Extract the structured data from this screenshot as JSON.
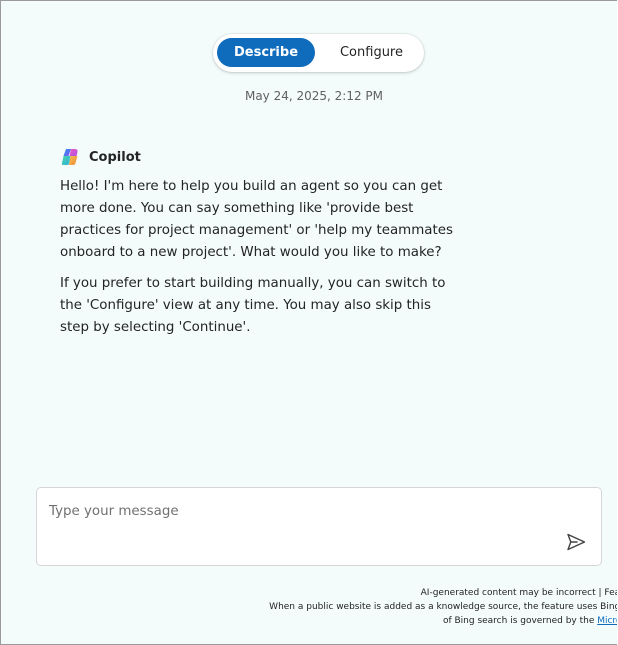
{
  "tabs": {
    "describe": "Describe",
    "configure": "Configure",
    "active": "Describe"
  },
  "timestamp": "May 24, 2025, 2:12 PM",
  "message": {
    "sender": "Copilot",
    "paragraph_1": "Hello! I'm here to help you build an agent so you can get more done. You can say something like 'provide best practices for project management' or 'help my teammates onboard to a new project'. What would you like to make?",
    "paragraph_2": "If you prefer to start building manually, you can switch to the 'Configure' view at any time. You may also skip this step by selecting 'Continue'."
  },
  "composer": {
    "placeholder": "Type your message",
    "value": "",
    "send_icon": "send-icon"
  },
  "footer": {
    "line_1": "AI-generated content may be incorrect | Features labeled",
    "line_2": "When a public website is added as a knowledge source, the feature uses Bing Search. Your",
    "line_3_prefix": "of Bing search is governed by the ",
    "line_3_link": "Microsoft Services"
  },
  "colors": {
    "accent": "#0f6cbd",
    "background": "#f3fbfb",
    "text": "#242424"
  }
}
